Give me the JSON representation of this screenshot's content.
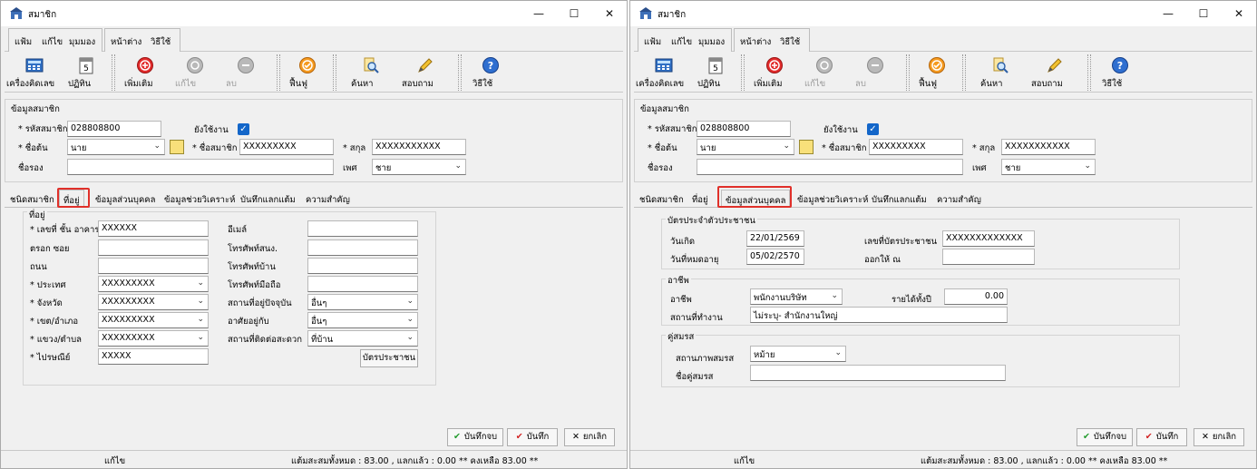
{
  "window": {
    "title": "สมาชิก",
    "controls": {
      "minimize": "—",
      "maximize": "☐",
      "close": "✕"
    }
  },
  "menu": {
    "group1": [
      "แฟ้ม",
      "แก้ไข",
      "มุมมอง"
    ],
    "group2": [
      "หน้าต่าง",
      "วิธีใช้"
    ]
  },
  "toolbar": {
    "calculator": "เครื่องคิดเลข",
    "calendar": "ปฏิทิน",
    "add": "เพิ่มเติม",
    "edit": "แก้ไข",
    "delete": "ลบ",
    "restore": "ฟื้นฟู",
    "search": "ค้นหา",
    "inquiry": "สอบถาม",
    "help": "วิธีใช้"
  },
  "member": {
    "section_title": "ข้อมูลสมาชิก",
    "member_code_label": "* รหัสสมาชิก",
    "member_code": "028808800",
    "active_label": "ยังใช้งาน",
    "prefix_label": "* ชื่อต้น",
    "prefix": "นาย",
    "first_name_label": "* ชื่อสมาชิก",
    "first_name": "XXXXXXXXX",
    "last_name_label": "* สกุล",
    "last_name": "XXXXXXXXXXX",
    "middle_name_label": "ชื่อรอง",
    "middle_name": "",
    "gender_label": "เพศ",
    "gender": "ชาย"
  },
  "tabs": [
    "ชนิดสมาชิก",
    "ที่อยู่",
    "ข้อมูลส่วนบุคคล",
    "ข้อมูลช่วยวิเคราะห์",
    "บันทึกแลกแต้ม",
    "ความสำคัญ"
  ],
  "address": {
    "group_title": "ที่อยู่",
    "house_label": "* เลขที่ ชั้น อาคาร",
    "house": "XXXXXX",
    "soi_label": "ตรอก ซอย",
    "soi": "",
    "road_label": "ถนน",
    "road": "",
    "country_label": "* ประเทศ",
    "country": "XXXXXXXXX",
    "province_label": "* จังหวัด",
    "province": "XXXXXXXXX",
    "district_label": "* เขต/อำเภอ",
    "district": "XXXXXXXXX",
    "subdistrict_label": "* แขวง/ตำบล",
    "subdistrict": "XXXXXXXXX",
    "postcode_label": "* ไปรษณีย์",
    "postcode": "XXXXX",
    "email_label": "อีเมล์",
    "email": "",
    "office_phone_label": "โทรศัพท์สนง.",
    "office_phone": "",
    "home_phone_label": "โทรศัพท์บ้าน",
    "home_phone": "",
    "mobile_label": "โทรศัพท์มือถือ",
    "mobile": "",
    "residence_label": "สถานที่อยู่ปัจจุบัน",
    "residence": "อื่นๆ",
    "living_with_label": "อาศัยอยู่กับ",
    "living_with": "อื่นๆ",
    "contact_place_label": "สถานที่ติดต่อสะดวก",
    "contact_place": "ที่บ้าน",
    "id_card_button": "บัตรประชาชน"
  },
  "personal": {
    "id_group_title": "บัตรประจำตัวประชาชน",
    "birth_date_label": "วันเกิด",
    "birth_date": "22/01/2569",
    "expiry_label": "วันที่หมดอายุ",
    "expiry": "05/02/2570",
    "id_number_label": "เลขที่บัตรประชาชน",
    "id_number": "XXXXXXXXXXXXX",
    "issued_by_label": "ออกให้ ณ",
    "issued_by": "",
    "job_group_title": "อาชีพ",
    "job_label": "อาชีพ",
    "job": "พนักงานบริษัท",
    "income_label": "รายได้ทั้งปี",
    "income": "0.00",
    "workplace_label": "สถานที่ทำงาน",
    "workplace": "ไม่ระบุ- สำนักงานใหญ่",
    "spouse_group_title": "คู่สมรส",
    "marital_label": "สถานภาพสมรส",
    "marital": "หม้าย",
    "spouse_name_label": "ชื่อคู่สมรส",
    "spouse_name": ""
  },
  "buttons": {
    "save_close": "บันทึกจบ",
    "save": "บันทึก",
    "cancel": "ยกเลิก"
  },
  "status": {
    "mode": "แก้ไข",
    "points_text": "แต้มสะสมทั้งหมด :   83.00 , แลกแล้ว :    0.00 ** คงเหลือ    83.00 **"
  },
  "colors": {
    "highlight": "#e0302a",
    "check": "#1366c9"
  }
}
